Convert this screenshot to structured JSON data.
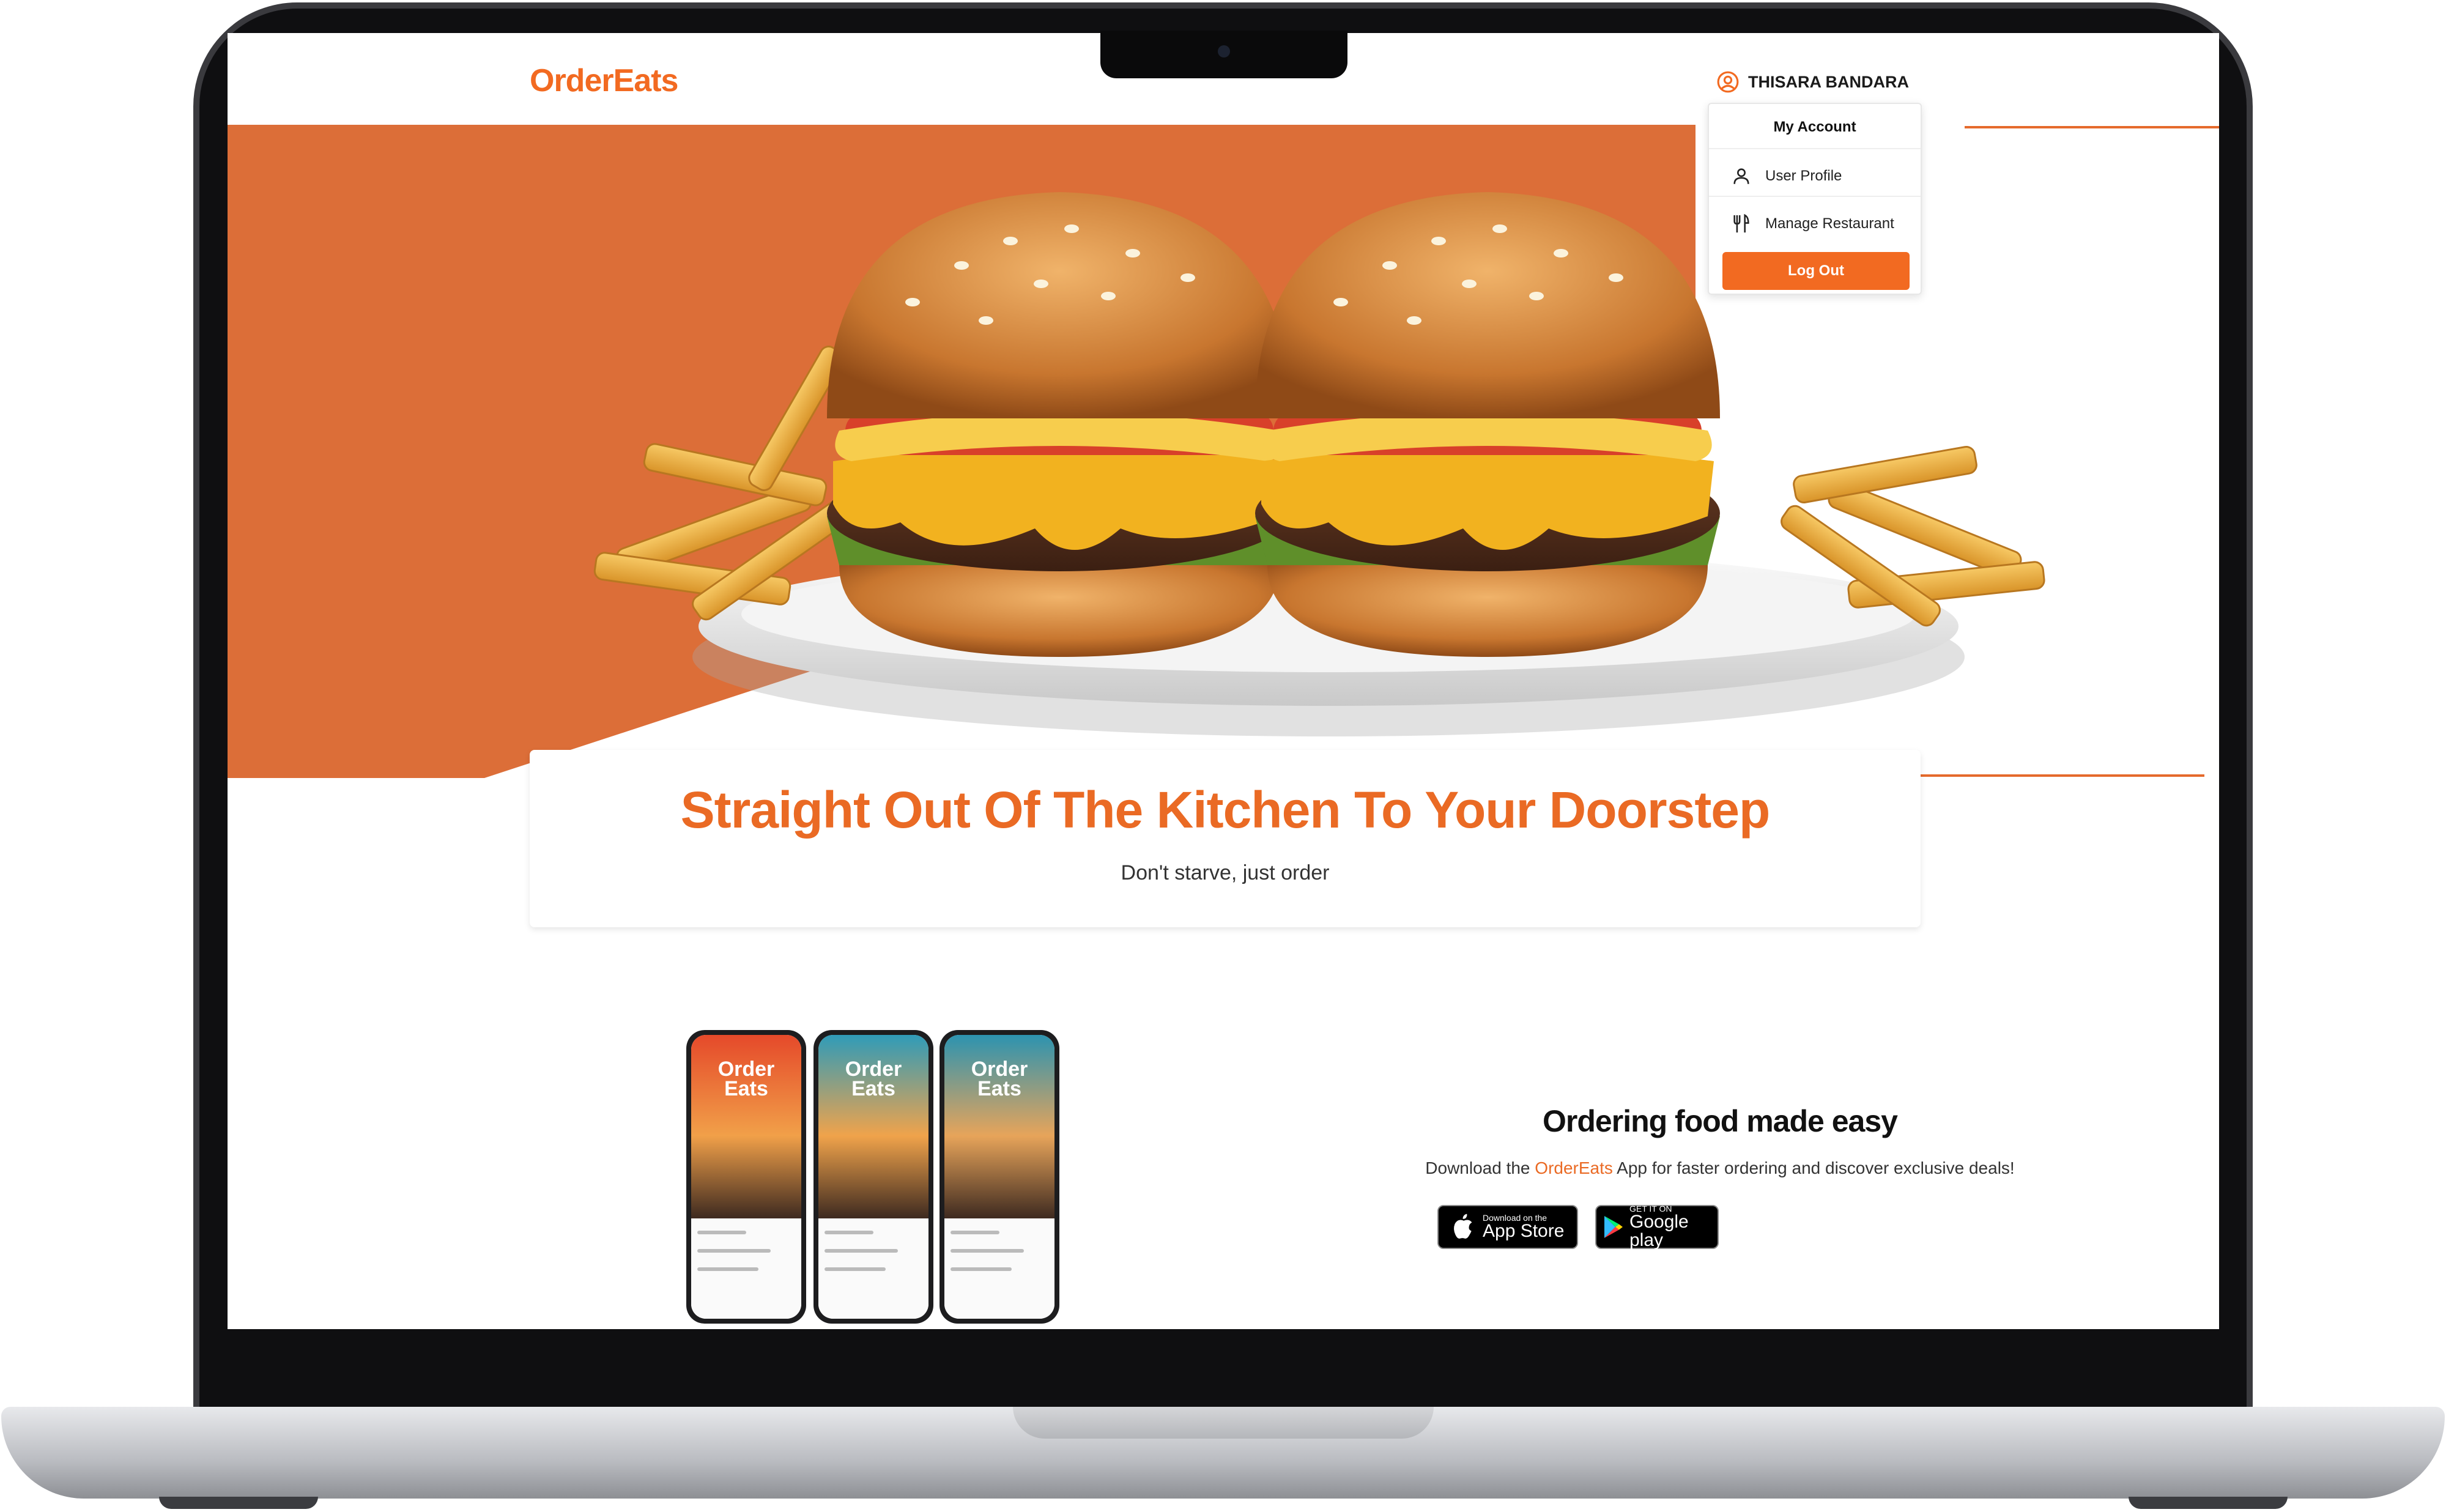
{
  "navbar": {
    "brand": "OrderEats",
    "user_name": "THISARA BANDARA"
  },
  "dropdown": {
    "title": "My Account",
    "items": [
      {
        "label": "User Profile",
        "icon": "user-icon"
      },
      {
        "label": "Manage Restaurant",
        "icon": "utensils-icon"
      }
    ],
    "logout_label": "Log Out"
  },
  "hero": {
    "headline": "Straight Out Of The Kitchen To Your Doorstep",
    "subheadline": "Don't starve, just order"
  },
  "app_promo": {
    "title": "Ordering food made easy",
    "text_before": "Download the ",
    "brand": "OrderEats",
    "text_after": " App for faster ordering and discover exclusive deals!",
    "phones": [
      {
        "title_line1": "Order",
        "title_line2": "Eats"
      },
      {
        "title_line1": "Order",
        "title_line2": "Eats"
      },
      {
        "title_line1": "Order",
        "title_line2": "Eats"
      }
    ],
    "app_store": {
      "small": "Download on the",
      "big": "App Store"
    },
    "google_play": {
      "small": "GET IT ON",
      "big": "Google play"
    }
  },
  "colors": {
    "brand": "#f26a21",
    "hero_bg": "#dc6e38",
    "headline": "#ea6a24"
  }
}
